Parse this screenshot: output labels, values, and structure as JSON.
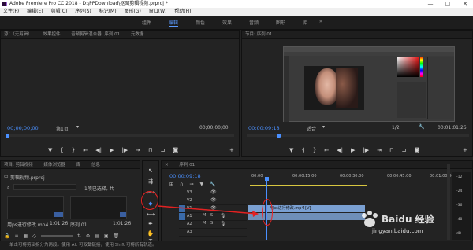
{
  "window": {
    "title": "Adobe Premiere Pro CC 2018 - D:\\PPDownload\\抠图剪辑视频.prproj *",
    "minimize": "—",
    "maximize": "☐",
    "close": "✕"
  },
  "menu": [
    "文件(F)",
    "编辑(E)",
    "剪辑(C)",
    "序列(S)",
    "标记(M)",
    "图形(G)",
    "窗口(W)",
    "帮助(H)"
  ],
  "workspaces": [
    {
      "label": "组件",
      "active": false
    },
    {
      "label": "编辑",
      "active": true
    },
    {
      "label": "颜色",
      "active": false
    },
    {
      "label": "效果",
      "active": false
    },
    {
      "label": "音频",
      "active": false
    },
    {
      "label": "图形",
      "active": false
    },
    {
      "label": "库",
      "active": false
    }
  ],
  "source_monitor": {
    "tabs": [
      "源：（无剪辑）",
      "效果控件",
      "音频剪辑混合器: 序列 01",
      "元数据"
    ],
    "timecode_left": "00;00;00;00",
    "page": "第1页",
    "timecode_right": "00;00;00;00"
  },
  "program_monitor": {
    "tab": "节目: 序列 01",
    "timecode_left": "00:00:09:18",
    "fit": "适合",
    "fraction": "1/2",
    "timecode_right": "00:01:01:26"
  },
  "project_panel": {
    "tabs": [
      "项目: 剪辑视频",
      "媒体浏览器",
      "库",
      "信息"
    ],
    "project_file": "剪辑视频.prproj",
    "selection_text": "1项已选择, 共",
    "items": [
      {
        "name": "用ps进行修改.mp4",
        "duration": "1:01:26"
      },
      {
        "name": "序列 01",
        "duration": "1:01:26"
      }
    ]
  },
  "timeline": {
    "tab": "序列 01",
    "timecode": "00:00:09:18",
    "ruler": [
      "00:00",
      "00:00:15:00",
      "00:00:30:00",
      "00:00:45:00",
      "00:01:00:00"
    ],
    "tracks": [
      "V3",
      "V2",
      "V1",
      "A1",
      "A2",
      "A3"
    ],
    "clip_label": "用ps进行修改.mp4 [V]",
    "meter_labels": [
      "-12",
      "-24",
      "-36",
      "-48",
      "dB"
    ]
  },
  "status": "单击可将剪辑拆分为两段。使用 Alt 可双截链接，使用 Shift 可将所有轨道。",
  "watermark": {
    "brand": "Baidu 经验",
    "url": "jingyan.baidu.com"
  },
  "colors": {
    "accent": "#4a90ff",
    "annotation": "#e22222",
    "clip": "#7aa0d2"
  }
}
